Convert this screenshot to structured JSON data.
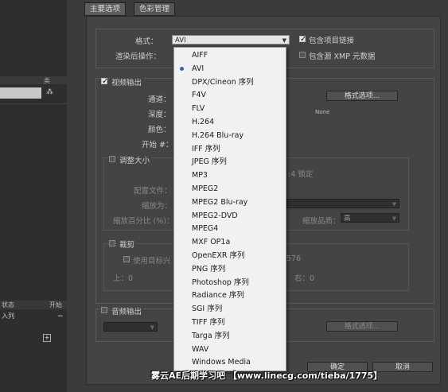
{
  "tabs": [
    "主要选项",
    "色彩管理"
  ],
  "format_row": {
    "label": "格式：",
    "value": "AVI"
  },
  "post_render": {
    "label": "渲染后操作："
  },
  "link_project": {
    "label": "包含项目链接",
    "checked": true
  },
  "include_xmp": {
    "label": "包含源 XMP 元数据",
    "checked": false
  },
  "video_output": {
    "label": "视频输出",
    "checked": true,
    "channels_label": "通道：",
    "depth_label": "深度：",
    "color_label": "颜色：",
    "start_label": "开始 #：",
    "format_options_button": "格式选项...",
    "compression_value": "None"
  },
  "resize": {
    "label": "调整大小",
    "lock_text": ":4 锁定",
    "preset_label": "配置文件：",
    "scale_label": "缩放为：",
    "percent_label": "缩放百分比 (%)：",
    "quality_label": "缩放品质：",
    "quality_value": "高"
  },
  "crop": {
    "label": "裁剪",
    "use_roi": "使用目标兴",
    "roi_value": "576",
    "top": "上：0",
    "right": "右：0"
  },
  "audio_output": {
    "label": "音频输出",
    "format_options_button": "格式选项..."
  },
  "buttons": {
    "ok": "确定",
    "cancel": "取消"
  },
  "left_panel": {
    "header_type": "类",
    "header_status": "状态",
    "header_start": "开始",
    "row_label": "入列"
  },
  "format_list": {
    "selected": "AVI",
    "items": [
      "AIFF",
      "AVI",
      "DPX/Cineon 序列",
      "F4V",
      "FLV",
      "H.264",
      "H.264 Blu-ray",
      "IFF 序列",
      "JPEG 序列",
      "MP3",
      "MPEG2",
      "MPEG2 Blu-ray",
      "MPEG2-DVD",
      "MPEG4",
      "MXF OP1a",
      "OpenEXR 序列",
      "PNG 序列",
      "Photoshop 序列",
      "Radiance 序列",
      "SGI 序列",
      "TIFF 序列",
      "Targa 序列",
      "WAV",
      "Windows Media"
    ]
  },
  "watermark": "雾云AE后期学习吧 【www.linecg.com/tieba/1775】"
}
